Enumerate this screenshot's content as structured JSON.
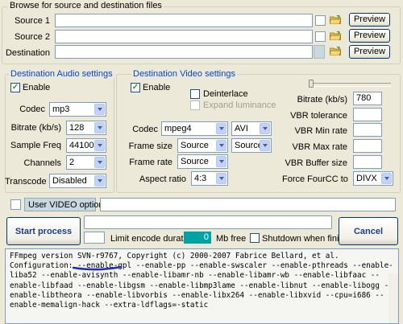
{
  "browse": {
    "title": "Browse for source and destination files",
    "source1_label": "Source 1",
    "source2_label": "Source 2",
    "destination_label": "Destination",
    "source1_value": "",
    "source2_value": "",
    "destination_value": "",
    "preview_label": "Preview"
  },
  "audio": {
    "title": "Destination Audio settings",
    "enable_label": "Enable",
    "enable_checked": true,
    "codec_label": "Codec",
    "codec_value": "mp3",
    "bitrate_label": "Bitrate (kb/s)",
    "bitrate_value": "128",
    "sample_freq_label": "Sample Freq",
    "sample_freq_value": "44100",
    "channels_label": "Channels",
    "channels_value": "2",
    "transcode_label": "Transcode",
    "transcode_value": "Disabled"
  },
  "video": {
    "title": "Destination Video settings",
    "enable_label": "Enable",
    "enable_checked": true,
    "deinterlace_label": "Deinterlace",
    "expand_luminance_label": "Expand luminance",
    "codec_label": "Codec",
    "codec_value": "mpeg4",
    "container_value": "AVI",
    "frame_size_label": "Frame size",
    "frame_size_value": "Source",
    "frame_size2_value": "Source",
    "frame_rate_label": "Frame rate",
    "frame_rate_value": "Source",
    "aspect_ratio_label": "Aspect ratio",
    "aspect_ratio_value": "4:3",
    "bitrate_label": "Bitrate (kb/s)",
    "bitrate_value": "780",
    "vbr_tolerance_label": "VBR tolerance",
    "vbr_tolerance_value": "",
    "vbr_min_label": "VBR Min rate",
    "vbr_min_value": "",
    "vbr_max_label": "VBR Max rate",
    "vbr_max_value": "",
    "vbr_buffer_label": "VBR Buffer size",
    "vbr_buffer_value": "",
    "fourcc_label": "Force FourCC to",
    "fourcc_value": "DIVX"
  },
  "user_options": {
    "label": "User VIDEO options >",
    "value": ""
  },
  "actions": {
    "start_label": "Start process",
    "cancel_label": "Cancel",
    "limit_value": "",
    "limit_label": "Limit encode duration",
    "free_value": "0",
    "free_unit": "Mb free",
    "shutdown_label": "Shutdown when finished"
  },
  "console": {
    "line1": "FFmpeg version SVN-r9767, Copyright (c) 2000-2007 Fabrice Bellard, et al.",
    "line2": "",
    "line3": "Configuration: --enable-gpl --enable-pp --enable-swscaler --enable-pthreads --enable-",
    "line4": "liba52 --enable-avisynth --enable-libamr-nb --enable-libamr-wb --enable-libfaac --",
    "line5": "enable-libfaad --enable-libgsm --enable-libmp3lame --enable-libnut --enable-libogg --",
    "line6": "enable-libtheora --enable-libvorbis --enable-libx264 --enable-libxvid --cpu=i686 --",
    "line7": "enable-memalign-hack --extra-ldflags=-static"
  },
  "colors": {
    "group_title": "#0046d5",
    "free_box": "#00a3a3",
    "annotation": "#1a2fb8"
  }
}
